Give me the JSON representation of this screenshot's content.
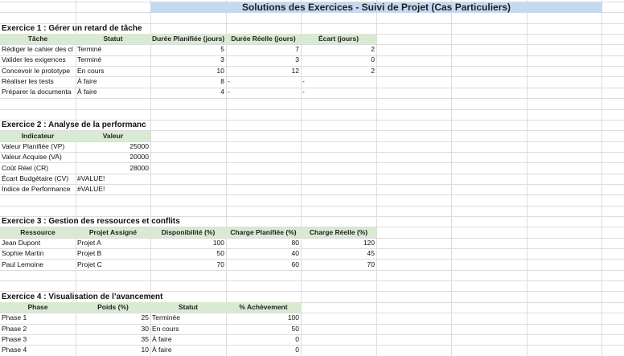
{
  "title": "Solutions des Exercices - Suivi de Projet (Cas Particuliers)",
  "colors": {
    "title_fill": "#c5d9f1",
    "header_fill": "#d9ead3",
    "gridline": "#dcdcdc"
  },
  "ex1": {
    "title": "Exercice 1 : Gérer un retard de tâche",
    "headers": [
      "Tâche",
      "Statut",
      "Durée Planifiée (jours)",
      "Durée Réelle (jours)",
      "Écart (jours)"
    ],
    "rows": [
      [
        "Rédiger le cahier des cl",
        "Terminé",
        "5",
        "7",
        "2"
      ],
      [
        "Valider les exigences",
        "Terminé",
        "3",
        "3",
        "0"
      ],
      [
        "Concevoir le prototype",
        "En cours",
        "10",
        "12",
        "2"
      ],
      [
        "Réaliser les tests",
        "À faire",
        "8",
        "-",
        "-"
      ],
      [
        "Préparer la documenta",
        "À faire",
        "4",
        "-",
        "-"
      ]
    ]
  },
  "ex2": {
    "title": "Exercice 2 : Analyse de la performanc",
    "headers": [
      "Indicateur",
      "Valeur"
    ],
    "rows": [
      [
        "Valeur Planifiée (VP)",
        "25000"
      ],
      [
        "Valeur Acquise (VA)",
        "20000"
      ],
      [
        "Coût Réel (CR)",
        "28000"
      ],
      [
        "Écart Budgétaire (CV)",
        "#VALUE!"
      ],
      [
        "Indice de Performance",
        "#VALUE!"
      ]
    ]
  },
  "ex3": {
    "title": "Exercice 3 : Gestion des ressources et conflits",
    "headers": [
      "Ressource",
      "Projet Assigné",
      "Disponibilité (%)",
      "Charge Planifiée (%)",
      "Charge Réelle (%)"
    ],
    "rows": [
      [
        "Jean Dupont",
        "Projet A",
        "100",
        "80",
        "120"
      ],
      [
        "Sophie Martin",
        "Projet B",
        "50",
        "40",
        "45"
      ],
      [
        "Paul Lemoine",
        "Projet C",
        "70",
        "60",
        "70"
      ]
    ]
  },
  "ex4": {
    "title": "Exercice 4 : Visualisation de l’avancement",
    "headers": [
      "Phase",
      "Poids (%)",
      "Statut",
      "% Achèvement"
    ],
    "rows": [
      [
        "Phase 1",
        "25",
        "Terminée",
        "100"
      ],
      [
        "Phase 2",
        "30",
        "En cours",
        "50"
      ],
      [
        "Phase 3",
        "35",
        "À faire",
        "0"
      ],
      [
        "Phase 4",
        "10",
        "À faire",
        "0"
      ]
    ]
  }
}
